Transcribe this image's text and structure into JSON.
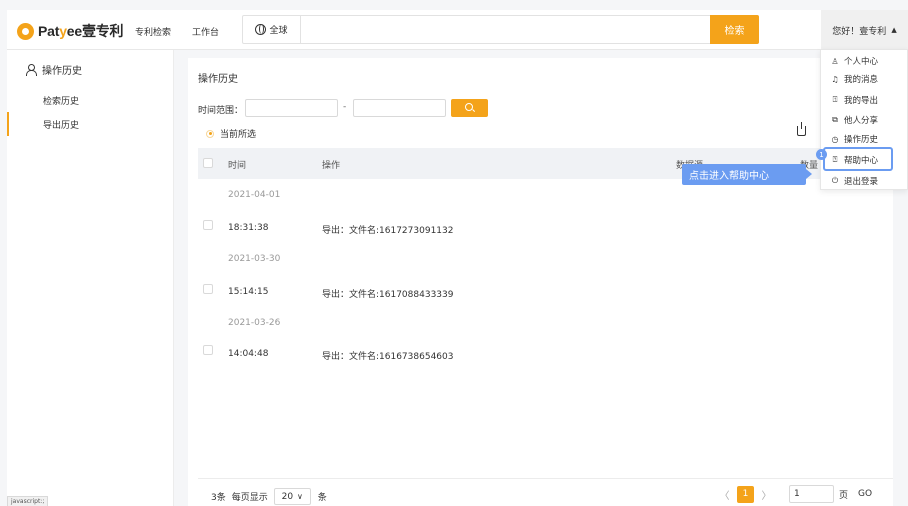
{
  "header": {
    "logo_prefix": "Pat",
    "logo_y": "y",
    "logo_suffix": "ee壹专利",
    "nav": [
      "专利检索",
      "工作台"
    ],
    "scope_label": "全球",
    "search_placeholder": "",
    "search_button": "检索",
    "user_greeting": "您好！壹专利",
    "caret": "▲"
  },
  "sidebar": {
    "title": "操作历史",
    "items": [
      {
        "label": "检索历史",
        "active": false
      },
      {
        "label": "导出历史",
        "active": true
      }
    ]
  },
  "status_bar": "javascript:;",
  "main": {
    "page_title": "操作历史",
    "range_label": "时间范围：",
    "range_sep": "-",
    "radio_label": "当前所选",
    "columns": {
      "time": "时间",
      "op": "操作",
      "source": "数据源",
      "count": "数量"
    },
    "groups": [
      {
        "date": "2021-04-01",
        "time": "18:31:38",
        "op": "导出：文件名:1617273091132"
      },
      {
        "date": "2021-03-30",
        "time": "15:14:15",
        "op": "导出：文件名:1617088433339"
      },
      {
        "date": "2021-03-26",
        "time": "14:04:48",
        "op": "导出：文件名:1616738654603"
      }
    ],
    "footer": {
      "total": "3条",
      "per_page_label": "每页显示",
      "per_page": "20",
      "unit": "条",
      "current_page": "1",
      "jump_value": "1",
      "page_label": "页",
      "go": "GO",
      "prev": "〈",
      "next": "〉"
    }
  },
  "dropdown": {
    "items": [
      {
        "icon": "person-icon",
        "glyph": "♙",
        "label": "个人中心"
      },
      {
        "icon": "bell-icon",
        "glyph": "♫",
        "label": "我的消息"
      },
      {
        "icon": "export-icon",
        "glyph": "⍐",
        "label": "我的导出"
      },
      {
        "icon": "share-icon",
        "glyph": "⧉",
        "label": "他人分享"
      },
      {
        "icon": "clock-icon",
        "glyph": "◷",
        "label": "操作历史"
      },
      {
        "icon": "help-icon",
        "glyph": "⍰",
        "label": "帮助中心"
      },
      {
        "icon": "logout-icon",
        "glyph": "⏻",
        "label": "退出登录"
      }
    ]
  },
  "guide": {
    "step": "1",
    "tooltip": "点击进入帮助中心",
    "color": "#6b9cf1"
  },
  "colors": {
    "accent": "#f4a31a"
  }
}
